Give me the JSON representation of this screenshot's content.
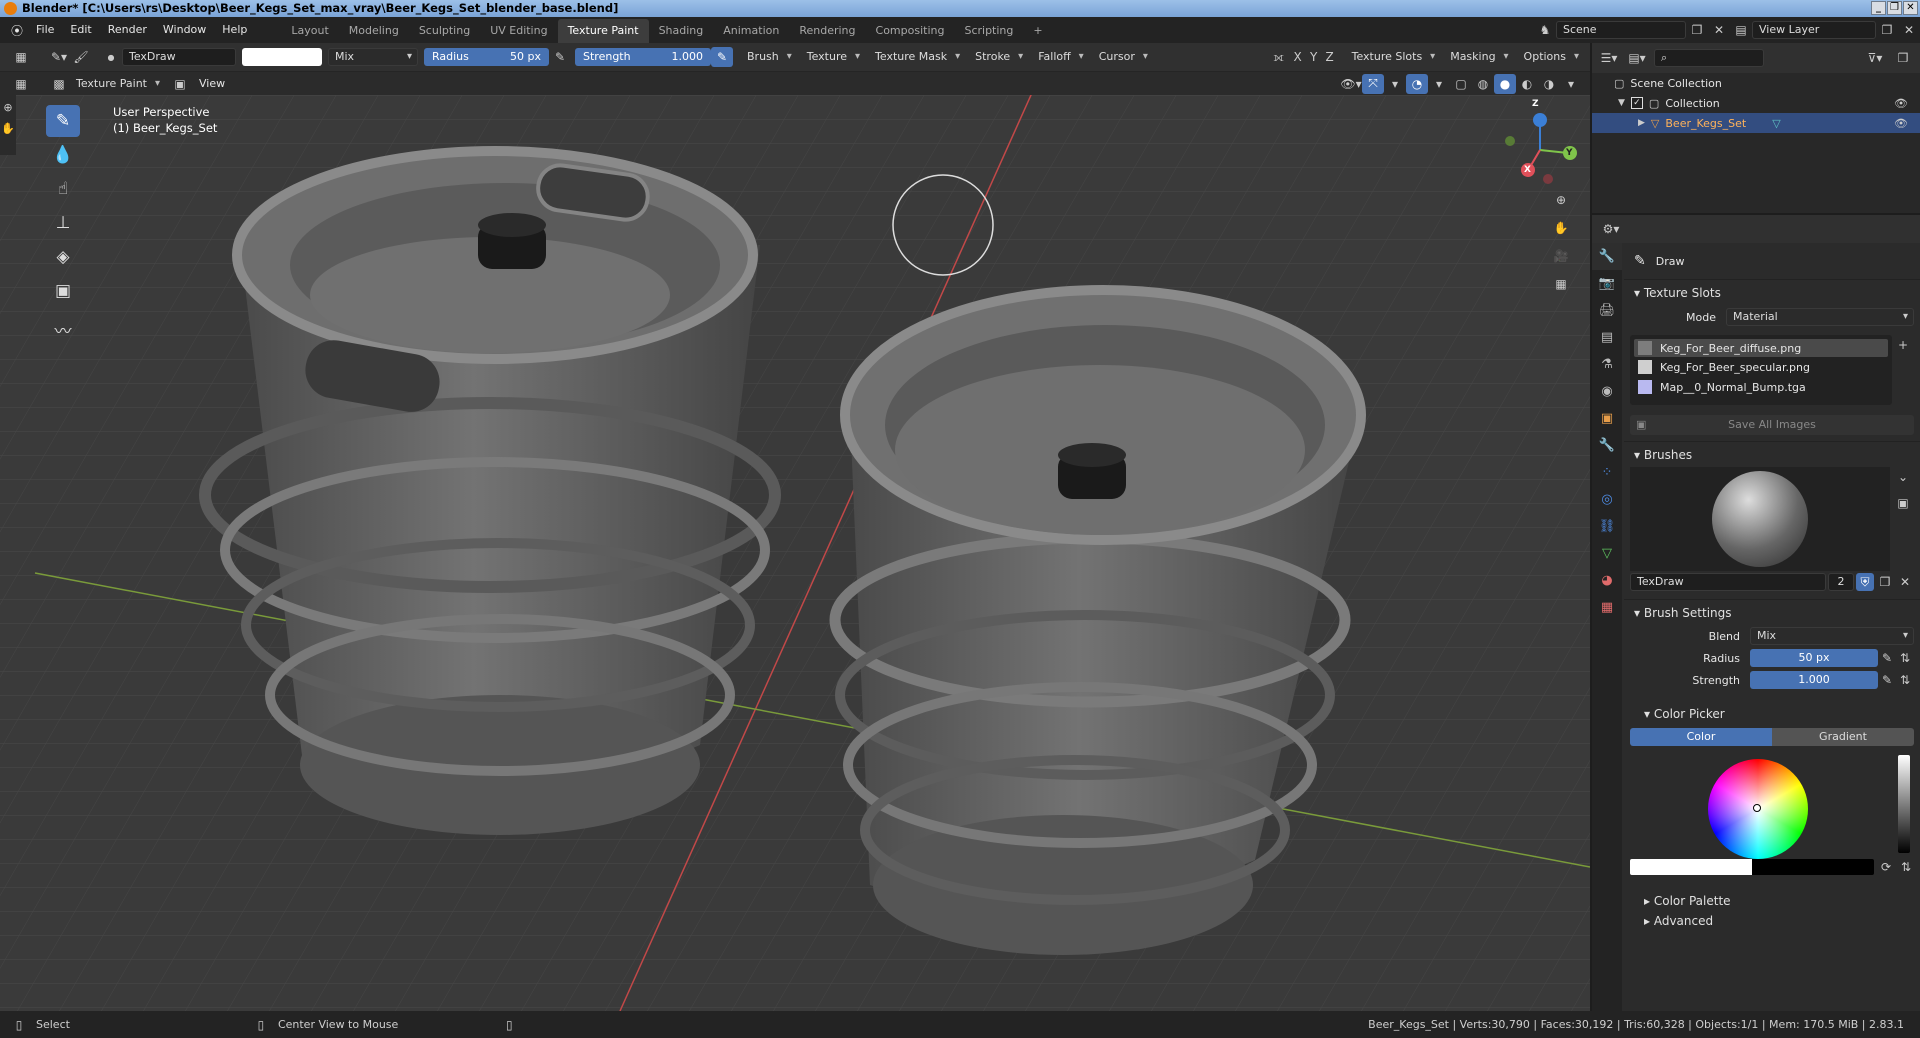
{
  "window": {
    "title": "Blender* [C:\\Users\\rs\\Desktop\\Beer_Kegs_Set_max_vray\\Beer_Kegs_Set_blender_base.blend]",
    "controls": [
      "_",
      "❐",
      "✕"
    ]
  },
  "menubar": {
    "menus": [
      "File",
      "Edit",
      "Render",
      "Window",
      "Help"
    ],
    "workspaces": [
      {
        "label": "Layout",
        "active": false
      },
      {
        "label": "Modeling",
        "active": false
      },
      {
        "label": "Sculpting",
        "active": false
      },
      {
        "label": "UV Editing",
        "active": false
      },
      {
        "label": "Texture Paint",
        "active": true
      },
      {
        "label": "Shading",
        "active": false
      },
      {
        "label": "Animation",
        "active": false
      },
      {
        "label": "Rendering",
        "active": false
      },
      {
        "label": "Compositing",
        "active": false
      },
      {
        "label": "Scripting",
        "active": false
      }
    ],
    "add_tab": "+",
    "scene": "Scene",
    "view_layer": "View Layer"
  },
  "toolbar": {
    "brush_name": "TexDraw",
    "blend": "Mix",
    "radius_label": "Radius",
    "radius_value": "50 px",
    "strength_label": "Strength",
    "strength_value": "1.000",
    "menus": [
      "Brush",
      "Texture",
      "Texture Mask",
      "Stroke",
      "Falloff",
      "Cursor"
    ],
    "axes": [
      "X",
      "Y",
      "Z"
    ],
    "right_menus": [
      "Texture Slots",
      "Masking",
      "Options"
    ]
  },
  "header2": {
    "mode": "Texture Paint",
    "view": "View"
  },
  "viewport": {
    "perspective": "User Perspective",
    "object_name": "(1) Beer_Kegs_Set",
    "gizmo": {
      "x": "X",
      "y": "Y",
      "z": "Z"
    },
    "brush_cursor_color": "#dddddd",
    "keg_color": "#6e6e6e"
  },
  "outliner": {
    "scene_collection": "Scene Collection",
    "collection": "Collection",
    "object": "Beer_Kegs_Set"
  },
  "properties": {
    "tool_name": "Draw",
    "texture_slots": {
      "title": "Texture Slots",
      "mode_label": "Mode",
      "mode_value": "Material",
      "slots": [
        {
          "name": "Keg_For_Beer_diffuse.png",
          "color": "#7d7d7d",
          "selected": true
        },
        {
          "name": "Keg_For_Beer_specular.png",
          "color": "#cfcfcf",
          "selected": false
        },
        {
          "name": "Map__0_Normal_Bump.tga",
          "color": "#b9b9f0",
          "selected": false
        }
      ],
      "save_all": "Save All Images"
    },
    "brushes": {
      "title": "Brushes",
      "brush_name": "TexDraw",
      "users": "2"
    },
    "brush_settings": {
      "title": "Brush Settings",
      "blend_label": "Blend",
      "blend_value": "Mix",
      "radius_label": "Radius",
      "radius_value": "50 px",
      "strength_label": "Strength",
      "strength_value": "1.000"
    },
    "color_picker": {
      "title": "Color Picker",
      "tab_color": "Color",
      "tab_gradient": "Gradient"
    },
    "color_palette": "Color Palette",
    "advanced": "Advanced"
  },
  "statusbar": {
    "select": "Select",
    "center_view": "Center View to Mouse",
    "stats": "Beer_Kegs_Set | Verts:30,790 | Faces:30,192 | Tris:60,328 | Objects:1/1 | Mem: 170.5 MiB | 2.83.1"
  }
}
